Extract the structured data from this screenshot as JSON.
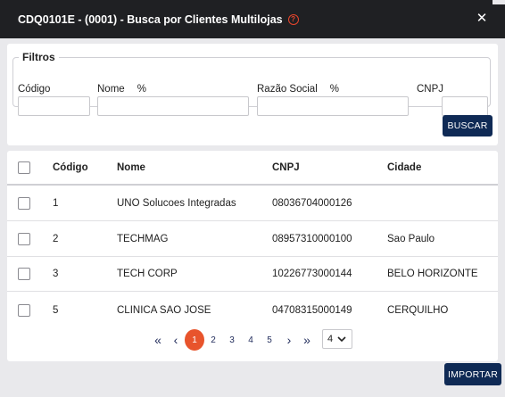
{
  "modal": {
    "title": "CDQ0101E - (0001) - Busca por Clientes Multilojas",
    "help_icon": "?",
    "close_icon": "✕"
  },
  "filters": {
    "legend": "Filtros",
    "codigo_label": "Código",
    "nome_label": "Nome",
    "nome_suffix": "%",
    "razao_label": "Razão Social",
    "razao_suffix": "%",
    "cnpj_label": "CNPJ",
    "codigo_value": "",
    "nome_value": "",
    "razao_value": "",
    "cnpj_value": "",
    "search_button": "BUSCAR"
  },
  "table": {
    "headers": [
      "Código",
      "Nome",
      "CNPJ",
      "Cidade"
    ],
    "rows": [
      {
        "codigo": "1",
        "nome": "UNO Solucoes Integradas",
        "cnpj": "08036704000126",
        "cidade": ""
      },
      {
        "codigo": "2",
        "nome": "TECHMAG",
        "cnpj": "08957310000100",
        "cidade": "Sao Paulo"
      },
      {
        "codigo": "3",
        "nome": "TECH CORP",
        "cnpj": "10226773000144",
        "cidade": "BELO HORIZONTE"
      },
      {
        "codigo": "5",
        "nome": "CLINICA SAO JOSE",
        "cnpj": "04708315000149",
        "cidade": "CERQUILHO"
      }
    ]
  },
  "pagination": {
    "first": "«",
    "prev": "‹",
    "pages": [
      "1",
      "2",
      "3",
      "4",
      "5"
    ],
    "current": "1",
    "next": "›",
    "last": "»",
    "page_size": "4",
    "page_size_icon": "chevron-down"
  },
  "footer": {
    "import_button": "IMPORTAR"
  },
  "colors": {
    "titlebar": "#1f2023",
    "primary_button": "#0f2a55",
    "active_page": "#e8542c",
    "help_icon": "#e8452c"
  }
}
